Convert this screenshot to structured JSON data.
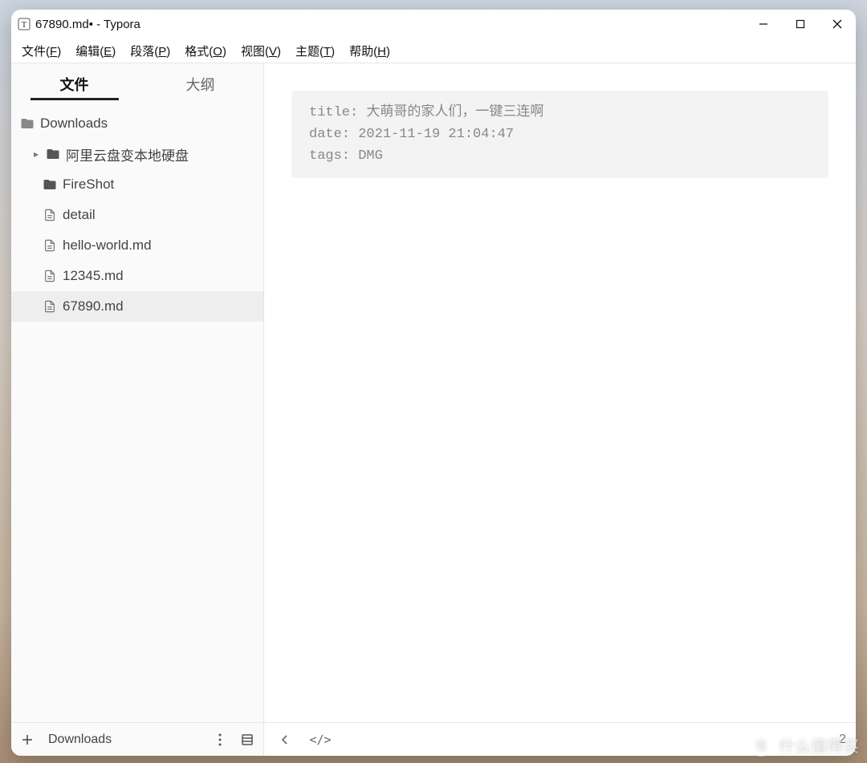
{
  "window": {
    "title": "67890.md• - Typora"
  },
  "menubar": {
    "items": [
      {
        "label": "文件",
        "hotkey": "F"
      },
      {
        "label": "编辑",
        "hotkey": "E"
      },
      {
        "label": "段落",
        "hotkey": "P"
      },
      {
        "label": "格式",
        "hotkey": "O"
      },
      {
        "label": "视图",
        "hotkey": "V"
      },
      {
        "label": "主题",
        "hotkey": "T"
      },
      {
        "label": "帮助",
        "hotkey": "H"
      }
    ]
  },
  "sidebar": {
    "tabs": {
      "files": "文件",
      "outline": "大纲"
    },
    "active_tab": "files",
    "root": {
      "name": "Downloads"
    },
    "items": [
      {
        "kind": "folder",
        "name": "阿里云盘变本地硬盘",
        "expandable": true
      },
      {
        "kind": "folder",
        "name": "FireShot",
        "expandable": false
      },
      {
        "kind": "file",
        "name": "detail"
      },
      {
        "kind": "file",
        "name": "hello-world.md"
      },
      {
        "kind": "file",
        "name": "12345.md"
      },
      {
        "kind": "file",
        "name": "67890.md",
        "selected": true
      }
    ],
    "footer_label": "Downloads"
  },
  "editor": {
    "frontmatter": {
      "title_key": "title:",
      "title_val": "大萌哥的家人们，一键三连啊",
      "date_key": "date:",
      "date_val": "2021-11-19 21:04:47",
      "tags_key": "tags:",
      "tags_val": "DMG"
    },
    "word_count": "2"
  },
  "watermark": {
    "badge": "值",
    "text": "什么值得买"
  }
}
